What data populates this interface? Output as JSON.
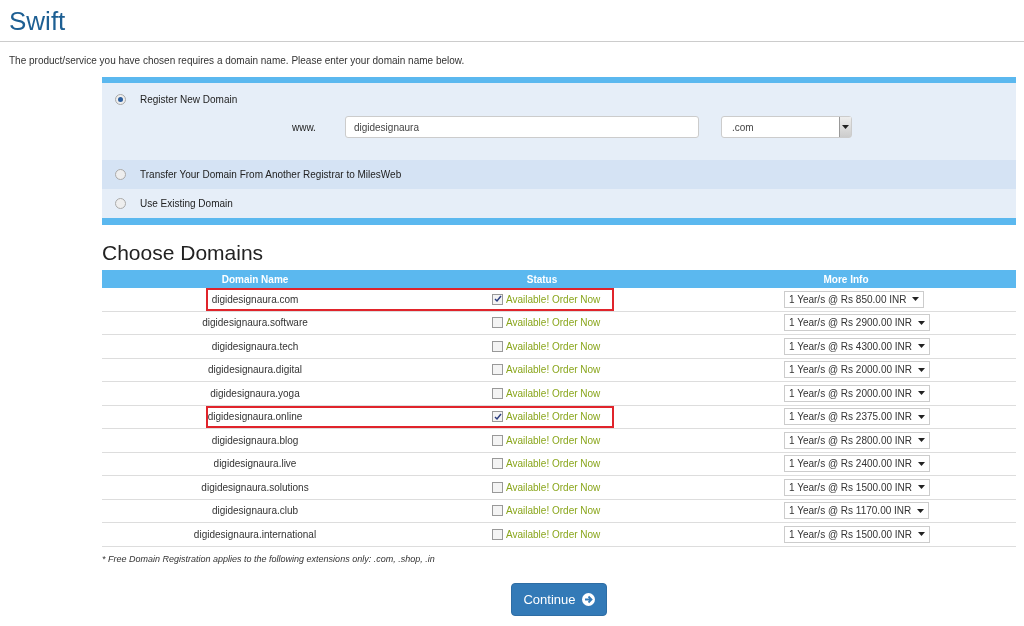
{
  "page_title": "Swift",
  "intro": "The product/service you have chosen requires a domain name. Please enter your domain name below.",
  "domain_options": [
    {
      "label": "Register New Domain",
      "selected": true
    },
    {
      "label": "Transfer Your Domain From Another Registrar to MilesWeb",
      "selected": false
    },
    {
      "label": "Use Existing Domain",
      "selected": false
    }
  ],
  "register_form": {
    "prefix": "www.",
    "domain_value": "digidesignaura",
    "tld": ".com"
  },
  "section_title": "Choose Domains",
  "table": {
    "columns": [
      "Domain Name",
      "Status",
      "More Info"
    ],
    "rows": [
      {
        "domain": "digidesignaura.com",
        "checked": true,
        "status": "Available! Order Now",
        "price": "1 Year/s @ Rs 850.00 INR",
        "highlighted": true
      },
      {
        "domain": "digidesignaura.software",
        "checked": false,
        "status": "Available! Order Now",
        "price": "1 Year/s @ Rs 2900.00 INR",
        "highlighted": false
      },
      {
        "domain": "digidesignaura.tech",
        "checked": false,
        "status": "Available! Order Now",
        "price": "1 Year/s @ Rs 4300.00 INR",
        "highlighted": false
      },
      {
        "domain": "digidesignaura.digital",
        "checked": false,
        "status": "Available! Order Now",
        "price": "1 Year/s @ Rs 2000.00 INR",
        "highlighted": false
      },
      {
        "domain": "digidesignaura.yoga",
        "checked": false,
        "status": "Available! Order Now",
        "price": "1 Year/s @ Rs 2000.00 INR",
        "highlighted": false
      },
      {
        "domain": "digidesignaura.online",
        "checked": true,
        "status": "Available! Order Now",
        "price": "1 Year/s @ Rs 2375.00 INR",
        "highlighted": true
      },
      {
        "domain": "digidesignaura.blog",
        "checked": false,
        "status": "Available! Order Now",
        "price": "1 Year/s @ Rs 2800.00 INR",
        "highlighted": false
      },
      {
        "domain": "digidesignaura.live",
        "checked": false,
        "status": "Available! Order Now",
        "price": "1 Year/s @ Rs 2400.00 INR",
        "highlighted": false
      },
      {
        "domain": "digidesignaura.solutions",
        "checked": false,
        "status": "Available! Order Now",
        "price": "1 Year/s @ Rs 1500.00 INR",
        "highlighted": false
      },
      {
        "domain": "digidesignaura.club",
        "checked": false,
        "status": "Available! Order Now",
        "price": "1 Year/s @ Rs 1170.00 INR",
        "highlighted": false
      },
      {
        "domain": "digidesignaura.international",
        "checked": false,
        "status": "Available! Order Now",
        "price": "1 Year/s @ Rs 1500.00 INR",
        "highlighted": false
      }
    ]
  },
  "footnote": "* Free Domain Registration applies to the following extensions only: .com, .shop, .in",
  "continue_button": "Continue"
}
